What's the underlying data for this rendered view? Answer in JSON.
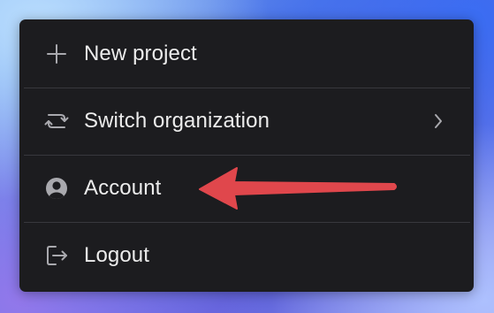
{
  "background": {
    "colors": [
      "#7fb0f0",
      "#4f74e6",
      "#5c61da",
      "#8f92ee"
    ]
  },
  "menu": {
    "background_color": "#1c1c1f",
    "text_color": "#ececec",
    "icon_color": "#a9a9ae",
    "items": [
      {
        "label": "New project",
        "icon": "plus-icon"
      },
      {
        "label": "Switch organization",
        "icon": "switch-arrows-icon",
        "has_submenu": true,
        "submenu_icon": "chevron-right-icon"
      },
      {
        "label": "Account",
        "icon": "user-circle-icon"
      },
      {
        "label": "Logout",
        "icon": "logout-icon"
      }
    ]
  },
  "annotation": {
    "type": "arrow",
    "icon": "arrow-left-icon",
    "color": "#e0474c",
    "points_to": "Account"
  }
}
